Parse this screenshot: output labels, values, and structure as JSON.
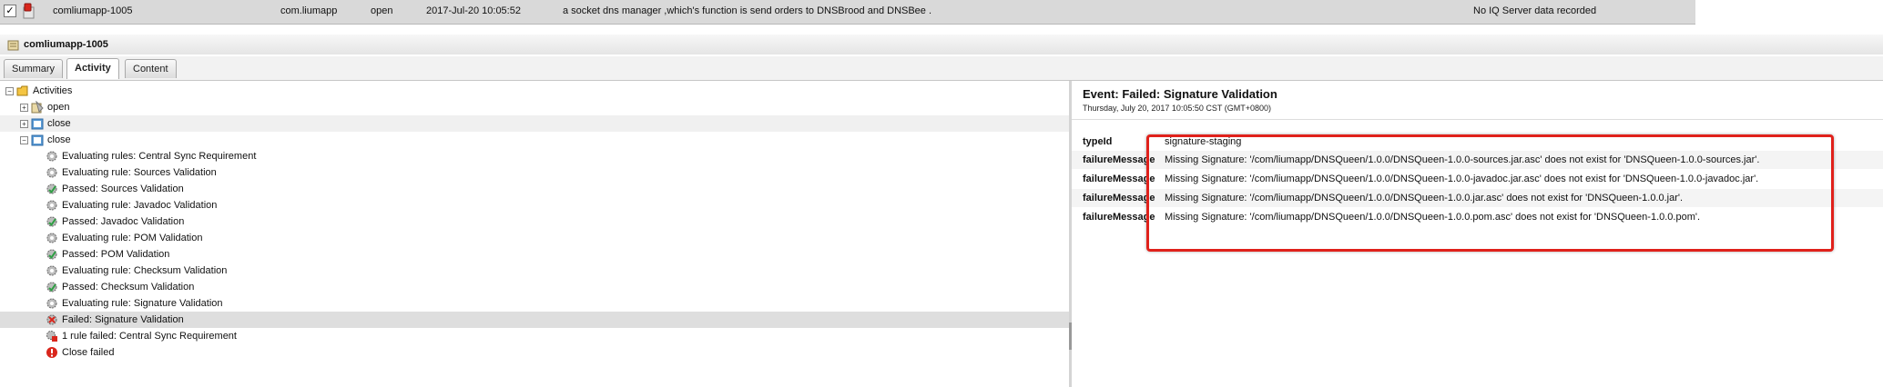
{
  "top_row": {
    "checkbox_mark": "✓",
    "name": "comliumapp-1005",
    "profile": "com.liumapp",
    "status": "open",
    "updated": "2017-Jul-20 10:05:52",
    "description": "a socket dns manager ,which's function is send orders to DNSBrood and DNSBee .",
    "iq": "No IQ Server data recorded"
  },
  "title": "comliumapp-1005",
  "tabs": [
    {
      "label": "Summary"
    },
    {
      "label": "Activity"
    },
    {
      "label": "Content"
    }
  ],
  "tree": {
    "root": "Activities",
    "nodes": [
      {
        "label": "open"
      },
      {
        "label": "close"
      },
      {
        "label": "close"
      }
    ],
    "steps": [
      {
        "label": "Evaluating rules: Central Sync Requirement"
      },
      {
        "label": "Evaluating rule: Sources Validation"
      },
      {
        "label": "Passed: Sources Validation"
      },
      {
        "label": "Evaluating rule: Javadoc Validation"
      },
      {
        "label": "Passed: Javadoc Validation"
      },
      {
        "label": "Evaluating rule: POM Validation"
      },
      {
        "label": "Passed: POM Validation"
      },
      {
        "label": "Evaluating rule: Checksum Validation"
      },
      {
        "label": "Passed: Checksum Validation"
      },
      {
        "label": "Evaluating rule: Signature Validation"
      },
      {
        "label": "Failed: Signature Validation"
      },
      {
        "label": "1 rule failed: Central Sync Requirement"
      },
      {
        "label": "Close failed"
      }
    ]
  },
  "event": {
    "title": "Event: Failed: Signature Validation",
    "date": "Thursday, July 20, 2017 10:05:50 CST (GMT+0800)",
    "properties": [
      {
        "key": "typeId",
        "value": "signature-staging"
      },
      {
        "key": "failureMessage",
        "value": "Missing Signature: '/com/liumapp/DNSQueen/1.0.0/DNSQueen-1.0.0-sources.jar.asc' does not exist for 'DNSQueen-1.0.0-sources.jar'."
      },
      {
        "key": "failureMessage",
        "value": "Missing Signature: '/com/liumapp/DNSQueen/1.0.0/DNSQueen-1.0.0-javadoc.jar.asc' does not exist for 'DNSQueen-1.0.0-javadoc.jar'."
      },
      {
        "key": "failureMessage",
        "value": "Missing Signature: '/com/liumapp/DNSQueen/1.0.0/DNSQueen-1.0.0.jar.asc' does not exist for 'DNSQueen-1.0.0.jar'."
      },
      {
        "key": "failureMessage",
        "value": "Missing Signature: '/com/liumapp/DNSQueen/1.0.0/DNSQueen-1.0.0.pom.asc' does not exist for 'DNSQueen-1.0.0.pom'."
      }
    ]
  },
  "colors": {
    "highlight": "#e0211b",
    "selected_row": "#dedede",
    "folder": "#f4c542",
    "error": "#d9261c",
    "gear": "#7d7d7d",
    "pass": "#4caf50"
  }
}
